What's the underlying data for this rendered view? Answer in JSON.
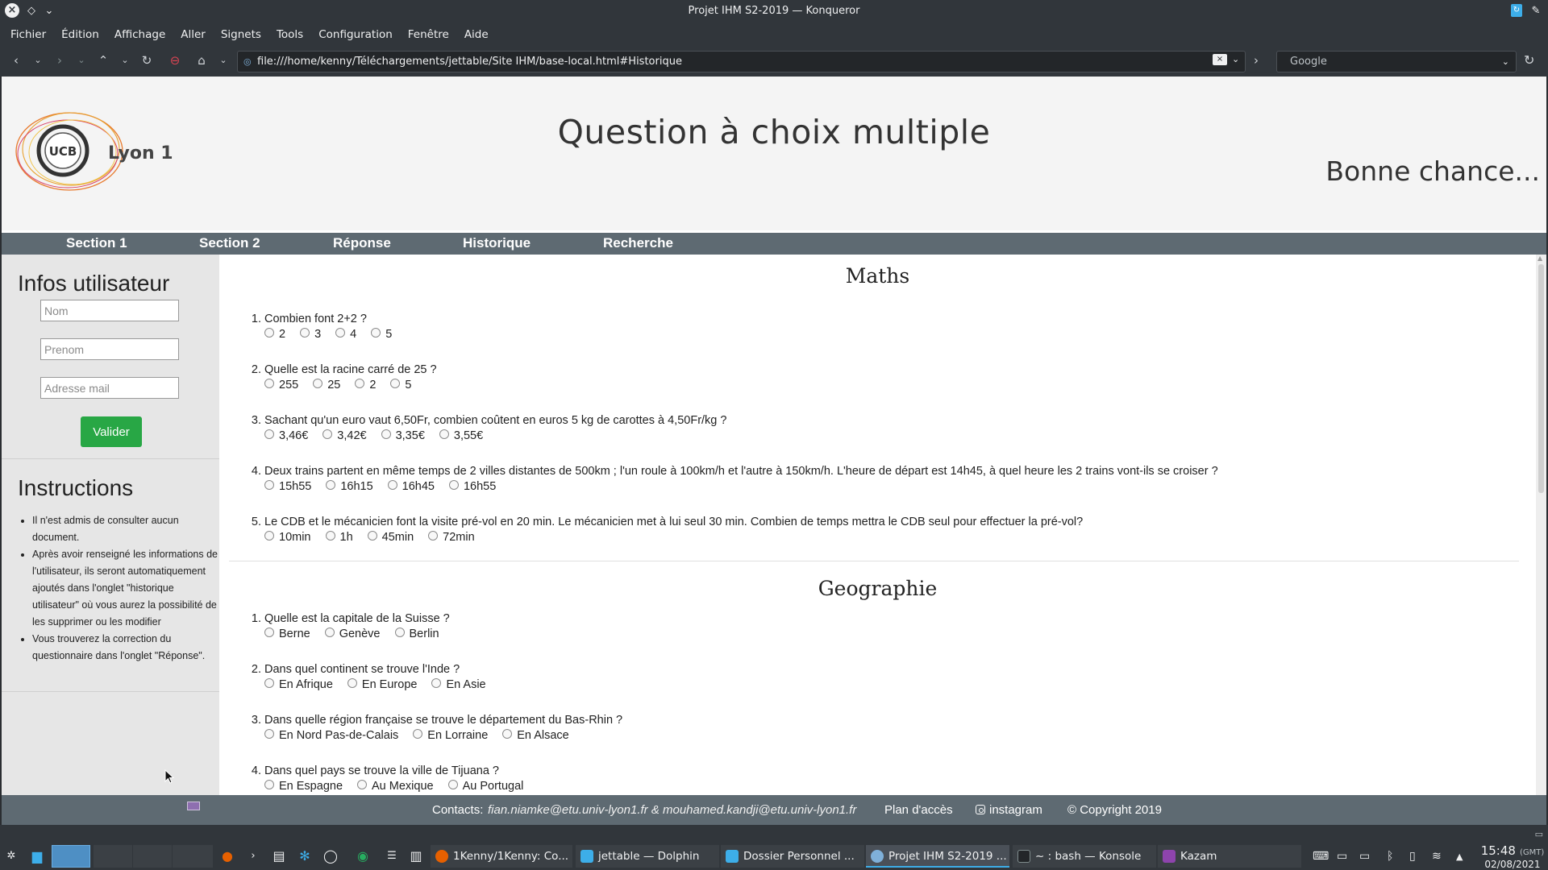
{
  "window": {
    "title": "Projet IHM S2-2019 — Konqueror"
  },
  "menu": [
    "Fichier",
    "Édition",
    "Affichage",
    "Aller",
    "Signets",
    "Tools",
    "Configuration",
    "Fenêtre",
    "Aide"
  ],
  "toolbar": {
    "url": "file:///home/kenny/Téléchargements/jettable/Site IHM/base-local.html#Historique",
    "search_placeholder": "Google"
  },
  "site": {
    "logo_text": "Lyon 1",
    "logo_mark": "UCB",
    "title": "Question à choix multiple",
    "tagline": "Bonne chance..."
  },
  "nav": [
    "Section 1",
    "Section 2",
    "Réponse",
    "Historique",
    "Recherche"
  ],
  "sidebar": {
    "user_heading": "Infos utilisateur",
    "fields": [
      {
        "placeholder": "Nom"
      },
      {
        "placeholder": "Prenom"
      },
      {
        "placeholder": "Adresse mail"
      }
    ],
    "submit_label": "Valider",
    "instructions_heading": "Instructions",
    "instructions": [
      "Il n'est admis de consulter aucun document.",
      "Après avoir renseigné les informations de l'utilisateur, ils seront automatiquement ajoutés dans l'onglet \"historique utilisateur\" où vous aurez la possibilité de les supprimer ou les modifier",
      "Vous trouverez la correction du questionnaire dans l'onglet \"Réponse\"."
    ]
  },
  "sections": [
    {
      "title": "Maths",
      "questions": [
        {
          "num": "1.",
          "text": "Combien font 2+2 ?",
          "options": [
            "2",
            "3",
            "4",
            "5"
          ]
        },
        {
          "num": "2.",
          "text": "Quelle est la racine carré de 25 ?",
          "options": [
            "255",
            "25",
            "2",
            "5"
          ]
        },
        {
          "num": "3.",
          "text": "Sachant qu'un euro vaut 6,50Fr, combien coûtent en euros 5 kg de carottes à 4,50Fr/kg ?",
          "options": [
            "3,46€",
            "3,42€",
            "3,35€",
            "3,55€"
          ]
        },
        {
          "num": "4.",
          "text": "Deux trains partent en même temps de 2 villes distantes de 500km ; l'un roule à 100km/h et l'autre à 150km/h. L'heure de départ est 14h45, à quel heure les 2 trains vont-ils se croiser ?",
          "options": [
            "15h55",
            "16h15",
            "16h45",
            "16h55"
          ]
        },
        {
          "num": "5.",
          "text": "Le CDB et le mécanicien font la visite pré-vol en 20 min. Le mécanicien met à lui seul 30 min. Combien de temps mettra le CDB seul pour effectuer la pré-vol?",
          "options": [
            "10min",
            "1h",
            "45min",
            "72min"
          ]
        }
      ]
    },
    {
      "title": "Geographie",
      "questions": [
        {
          "num": "1.",
          "text": "Quelle est la capitale de la Suisse ?",
          "options": [
            "Berne",
            "Genève",
            "Berlin"
          ]
        },
        {
          "num": "2.",
          "text": "Dans quel continent se trouve l'Inde ?",
          "options": [
            "En Afrique",
            "En Europe",
            "En Asie"
          ]
        },
        {
          "num": "3.",
          "text": "Dans quelle région française se trouve le département du Bas-Rhin ?",
          "options": [
            "En Nord Pas-de-Calais",
            "En Lorraine",
            "En Alsace"
          ]
        },
        {
          "num": "4.",
          "text": "Dans quel pays se trouve la ville de Tijuana ?",
          "options": [
            "En Espagne",
            "Au Mexique",
            "Au Portugal"
          ]
        }
      ]
    }
  ],
  "footer": {
    "contacts_label": "Contacts:",
    "contacts_emails": "fian.niamke@etu.univ-lyon1.fr & mouhamed.kandji@etu.univ-lyon1.fr",
    "plan": "Plan d'accès",
    "instagram": "instagram",
    "copyright": "© Copyright 2019"
  },
  "taskbar": {
    "tasks": [
      {
        "label": "1Kenny/1Kenny: Co...",
        "color": "#e66000"
      },
      {
        "label": "jettable — Dolphin",
        "color": "#3daee9"
      },
      {
        "label": "Dossier Personnel ...",
        "color": "#3daee9"
      },
      {
        "label": "Projet IHM S2-2019 ...",
        "color": "#7fb0d9"
      },
      {
        "label": "~ : bash — Konsole",
        "color": "#232629"
      },
      {
        "label": "Kazam",
        "color": "#8e44ad"
      }
    ],
    "clock_time": "15:48",
    "clock_tz": "(GMT)",
    "clock_date": "02/08/2021"
  },
  "colors": {
    "nav_bg": "#5e6a72",
    "valider_bg": "#28a745",
    "kde_accent": "#3daee9"
  }
}
